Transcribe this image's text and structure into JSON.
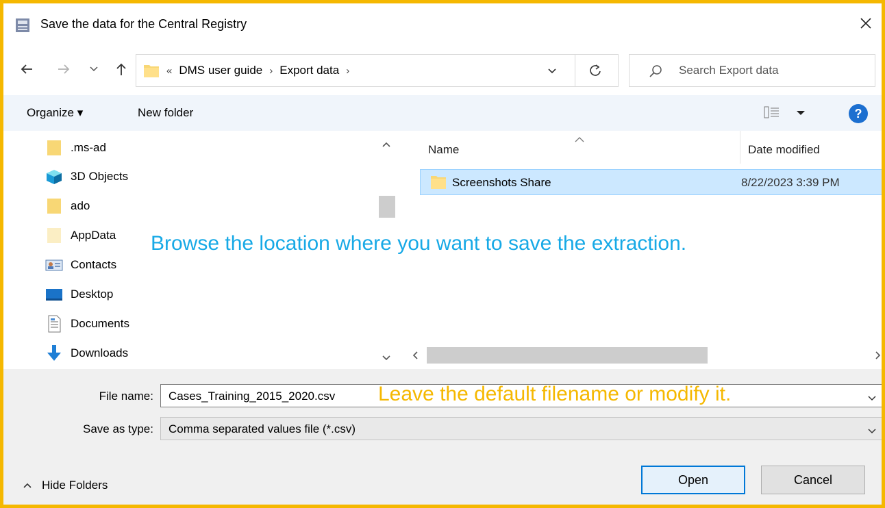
{
  "window": {
    "title": "Save the data for the Central Registry",
    "close_icon": "close-icon"
  },
  "address": {
    "overflow": "«",
    "crumbs": [
      "DMS user guide",
      "Export data"
    ],
    "separator": "›"
  },
  "search": {
    "placeholder": "Search Export data"
  },
  "toolbar": {
    "organize_label": "Organize ▾",
    "new_folder_label": "New folder",
    "help_label": "?"
  },
  "nav_pane": {
    "items": [
      {
        "label": ".ms-ad",
        "icon": "folder-icon"
      },
      {
        "label": "3D Objects",
        "icon": "cube-icon"
      },
      {
        "label": "ado",
        "icon": "folder-icon"
      },
      {
        "label": "AppData",
        "icon": "folder-pale-icon"
      },
      {
        "label": "Contacts",
        "icon": "contacts-icon"
      },
      {
        "label": "Desktop",
        "icon": "desktop-icon"
      },
      {
        "label": "Documents",
        "icon": "documents-icon"
      },
      {
        "label": "Downloads",
        "icon": "download-arrow-icon"
      }
    ]
  },
  "file_list": {
    "columns": {
      "name": "Name",
      "date": "Date modified"
    },
    "rows": [
      {
        "name": "Screenshots Share",
        "date": "8/22/2023 3:39 PM",
        "selected": true
      }
    ]
  },
  "form": {
    "file_name_label": "File name:",
    "file_name_value": "Cases_Training_2015_2020.csv",
    "save_type_label": "Save as type:",
    "save_type_value": "Comma separated values file (*.csv)"
  },
  "buttons": {
    "open": "Open",
    "cancel": "Cancel",
    "hide_folders": "Hide Folders"
  },
  "annotations": {
    "browse": "Browse the location where you want to save the extraction.",
    "filename": "Leave the default filename or modify it."
  },
  "colors": {
    "frame_border": "#f5b800",
    "annotation_blue": "#17a9e6",
    "annotation_orange": "#f5b800",
    "selection": "#cce8ff",
    "help_blue": "#1c6fd0"
  }
}
